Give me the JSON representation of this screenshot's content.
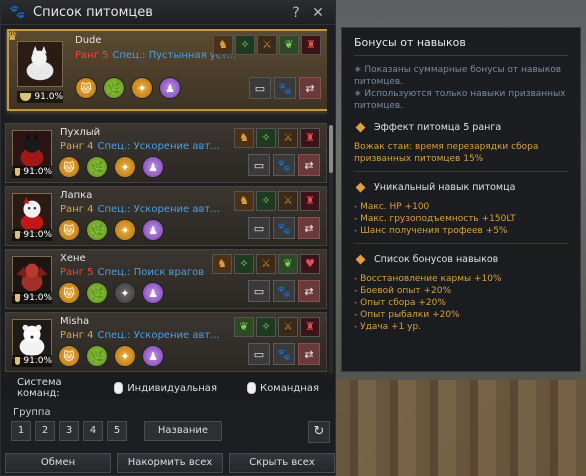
{
  "window": {
    "title": "Список питомцев",
    "help_label": "?",
    "close_label": "✕"
  },
  "pets": [
    {
      "name": "Dude",
      "rank_label": "Ранг 5",
      "rank_level": 5,
      "spec": "Спец.: Пустынная уст...",
      "hunger": "91.0%",
      "animal": "white wolf dog",
      "selected": true
    },
    {
      "name": "Пухлый",
      "rank_label": "Ранг 4",
      "rank_level": 4,
      "spec": "Спец.: Ускорение авт...",
      "hunger": "91.0%",
      "animal": "black cat in red",
      "selected": false
    },
    {
      "name": "Лапка",
      "rank_label": "Ранг 4",
      "rank_level": 4,
      "spec": "Спец.: Ускорение авт...",
      "hunger": "91.0%",
      "animal": "white dog in red",
      "selected": false
    },
    {
      "name": "Хене",
      "rank_label": "Ранг 5",
      "rank_level": 5,
      "spec": "Спец.: Поиск врагов",
      "hunger": "91.0%",
      "animal": "red dragon",
      "selected": false
    },
    {
      "name": "Misha",
      "rank_label": "Ранг 4",
      "rank_level": 4,
      "spec": "Спец.: Ускорение авт...",
      "hunger": "91.0%",
      "animal": "white bear",
      "selected": false
    }
  ],
  "command_system": {
    "label": "Система команд:",
    "individual": "Индивидуальная",
    "team": "Командная"
  },
  "group": {
    "label": "Группа",
    "buttons": [
      "1",
      "2",
      "3",
      "4",
      "5"
    ],
    "name_button": "Название"
  },
  "bottom_buttons": {
    "exchange": "Обмен",
    "feed_all": "Накормить всех",
    "hide_all": "Скрыть всех"
  },
  "bonus_panel": {
    "title": "Бонусы от навыков",
    "note1": "∗ Показаны суммарные бонусы от навыков питомцев.",
    "note2": "∗ Используются только навыки призванных питомцев.",
    "section1_title": "Эффект питомца 5 ранга",
    "section1_lines": [
      "Вожак стаи: время перезарядки сбора призванных питомцев  15%"
    ],
    "section2_title": "Уникальный навык питомца",
    "section2_lines": [
      "- Макс. HP +100",
      "- Макс. грузоподъемность +150LT",
      "- Шанс получения трофеев +5%"
    ],
    "section3_title": "Список бонусов навыков",
    "section3_lines": [
      "- Восстановление кармы +10%",
      "- Боевой опыт +20%",
      "- Опыт сбора +20%",
      "- Опыт рыбалки +20%",
      "- Удача +1 ур."
    ]
  },
  "icons": {
    "title_icon": "paw-icon",
    "crown": "crown-icon",
    "skills": [
      "cat-skill-icon",
      "leaf-skill-icon",
      "compass-skill-icon",
      "potion-skill-icon"
    ],
    "actions": [
      "feed-icon",
      "paw-command-icon",
      "release-icon"
    ]
  }
}
